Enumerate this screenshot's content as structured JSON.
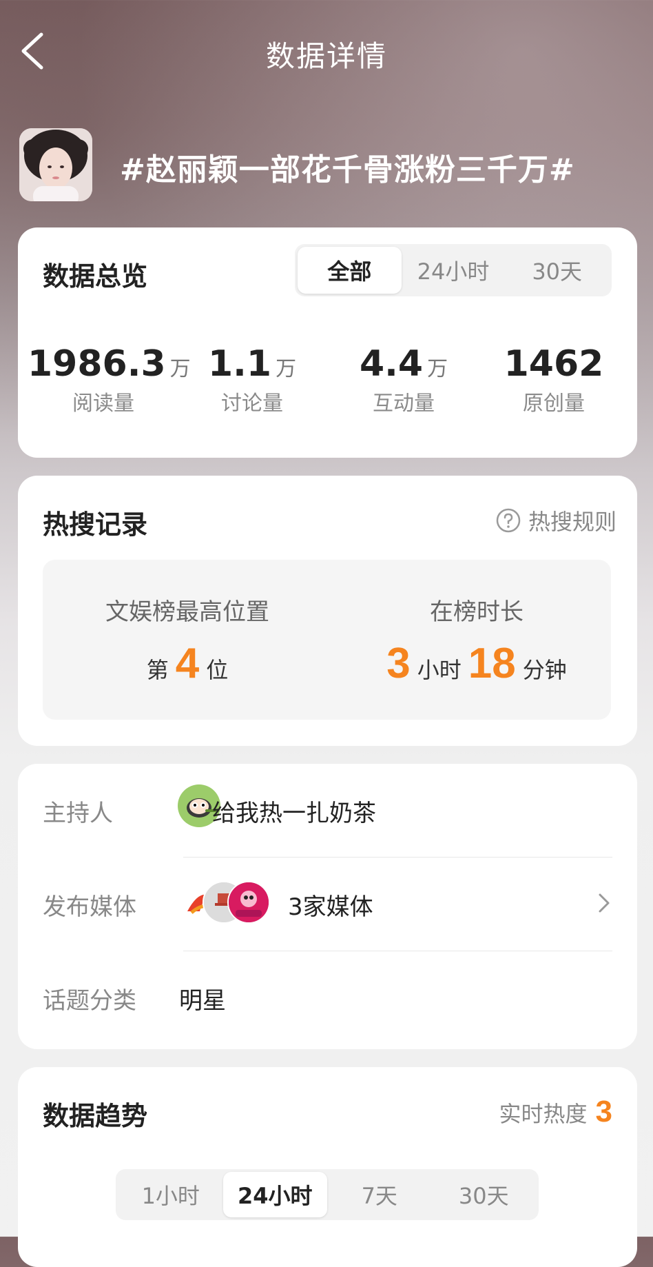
{
  "nav": {
    "title": "数据详情"
  },
  "topic": {
    "title": "#赵丽颖一部花千骨涨粉三千万#"
  },
  "overview": {
    "title": "数据总览",
    "tabs": [
      "全部",
      "24小时",
      "30天"
    ],
    "active_tab": "全部",
    "stats": [
      {
        "value": "1986.3",
        "unit": "万",
        "label": "阅读量"
      },
      {
        "value": "1.1",
        "unit": "万",
        "label": "讨论量"
      },
      {
        "value": "4.4",
        "unit": "万",
        "label": "互动量"
      },
      {
        "value": "1462",
        "unit": "",
        "label": "原创量"
      }
    ]
  },
  "hot_search": {
    "title": "热搜记录",
    "rules_label": "热搜规则",
    "best_rank": {
      "label": "文娱榜最高位置",
      "prefix": "第",
      "value": "4",
      "suffix": "位"
    },
    "duration": {
      "label": "在榜时长",
      "hours": "3",
      "hours_unit": "小时",
      "minutes": "18",
      "minutes_unit": "分钟"
    }
  },
  "info": {
    "host": {
      "label": "主持人",
      "value": "给我热一扎奶茶"
    },
    "media": {
      "label": "发布媒体",
      "value": "3家媒体"
    },
    "category": {
      "label": "话题分类",
      "value": "明星"
    }
  },
  "trend": {
    "title": "数据趋势",
    "heat_label": "实时热度",
    "heat_value": "3",
    "tabs": [
      "1小时",
      "24小时",
      "7天",
      "30天"
    ],
    "active_tab": "24小时"
  },
  "colors": {
    "accent": "#f5841f",
    "card": "#ffffff",
    "muted": "#888888"
  }
}
